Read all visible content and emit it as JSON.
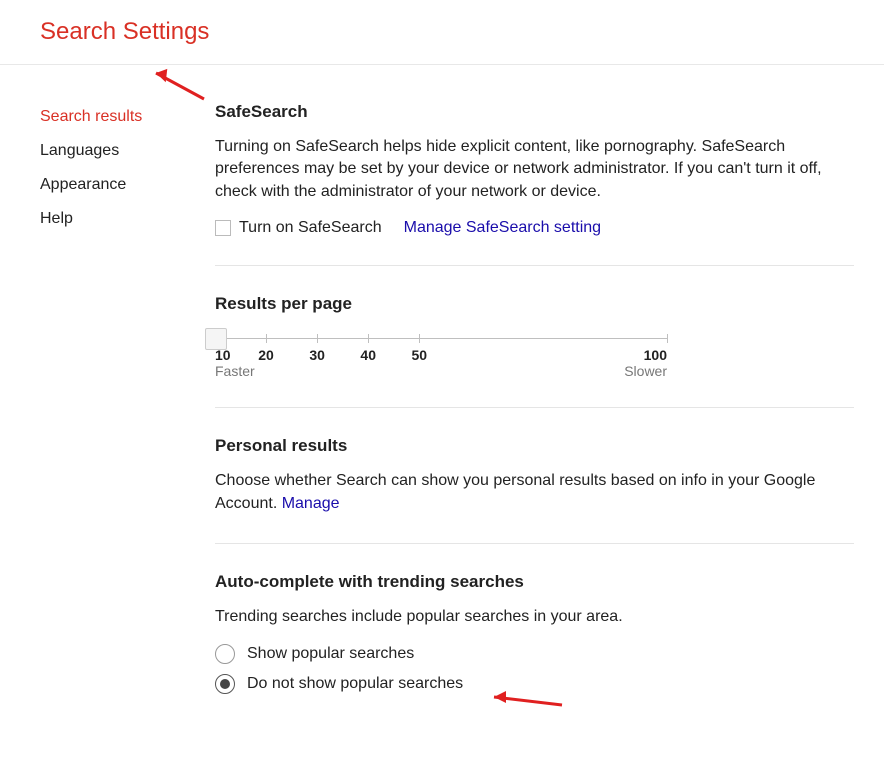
{
  "header": {
    "title": "Search Settings"
  },
  "sidebar": {
    "items": [
      {
        "label": "Search results",
        "active": true
      },
      {
        "label": "Languages"
      },
      {
        "label": "Appearance"
      },
      {
        "label": "Help"
      }
    ]
  },
  "safesearch": {
    "title": "SafeSearch",
    "description": "Turning on SafeSearch helps hide explicit content, like pornography. SafeSearch preferences may be set by your device or network administrator. If you can't turn it off, check with the administrator of your network or device.",
    "checkbox_label": "Turn on SafeSearch",
    "checkbox_checked": false,
    "manage_link": "Manage SafeSearch setting"
  },
  "results_per_page": {
    "title": "Results per page",
    "ticks": [
      "10",
      "20",
      "30",
      "40",
      "50",
      "100"
    ],
    "value": "10",
    "left_hint": "Faster",
    "right_hint": "Slower"
  },
  "personal_results": {
    "title": "Personal results",
    "description": "Choose whether Search can show you personal results based on info in your Google Account. ",
    "manage_link": "Manage"
  },
  "autocomplete": {
    "title": "Auto-complete with trending searches",
    "description": "Trending searches include popular searches in your area.",
    "options": [
      {
        "label": "Show popular searches",
        "selected": false
      },
      {
        "label": "Do not show popular searches",
        "selected": true
      }
    ]
  }
}
